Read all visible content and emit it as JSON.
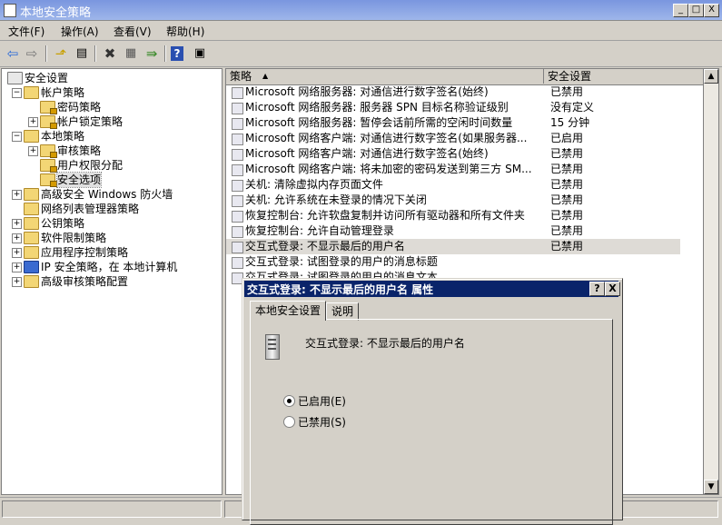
{
  "window": {
    "title": "本地安全策略",
    "min": "_",
    "max": "□",
    "close": "X"
  },
  "menu": [
    "文件(F)",
    "操作(A)",
    "查看(V)",
    "帮助(H)"
  ],
  "toolbar": [
    "back-icon",
    "forward-icon",
    "up-folder-icon",
    "show-hide-tree-icon",
    "delete-icon",
    "properties-icon",
    "export-icon",
    "help-icon",
    "console-icon"
  ],
  "tree": {
    "nodes": [
      {
        "label": "安全设置",
        "level": 0,
        "expander": "",
        "icon": "security-settings-icon"
      },
      {
        "label": "帐户策略",
        "level": 1,
        "expander": "-",
        "icon": "folder-icon"
      },
      {
        "label": "密码策略",
        "level": 2,
        "expander": "",
        "icon": "folder-icon"
      },
      {
        "label": "帐户锁定策略",
        "level": 2,
        "expander": "+",
        "icon": "folder-icon"
      },
      {
        "label": "本地策略",
        "level": 1,
        "expander": "-",
        "icon": "folder-icon"
      },
      {
        "label": "审核策略",
        "level": 2,
        "expander": "+",
        "icon": "folder-icon"
      },
      {
        "label": "用户权限分配",
        "level": 2,
        "expander": "",
        "icon": "folder-icon"
      },
      {
        "label": "安全选项",
        "level": 2,
        "expander": "",
        "icon": "folder-icon",
        "selected": true
      },
      {
        "label": "高级安全 Windows 防火墙",
        "level": 1,
        "expander": "+",
        "icon": "folder-icon"
      },
      {
        "label": "网络列表管理器策略",
        "level": 1,
        "expander": "",
        "icon": "folder-icon"
      },
      {
        "label": "公钥策略",
        "level": 1,
        "expander": "+",
        "icon": "folder-icon"
      },
      {
        "label": "软件限制策略",
        "level": 1,
        "expander": "+",
        "icon": "folder-icon"
      },
      {
        "label": "应用程序控制策略",
        "level": 1,
        "expander": "+",
        "icon": "folder-icon"
      },
      {
        "label": "IP 安全策略，在 本地计算机",
        "level": 1,
        "expander": "+",
        "icon": "ip-security-icon"
      },
      {
        "label": "高级审核策略配置",
        "level": 1,
        "expander": "+",
        "icon": "folder-icon"
      }
    ]
  },
  "list": {
    "columns": [
      "策略",
      "安全设置"
    ],
    "rows": [
      {
        "policy": "Microsoft 网络服务器: 对通信进行数字签名(始终)",
        "setting": "已禁用"
      },
      {
        "policy": "Microsoft 网络服务器: 服务器 SPN 目标名称验证级别",
        "setting": "没有定义"
      },
      {
        "policy": "Microsoft 网络服务器: 暂停会话前所需的空闲时间数量",
        "setting": "15 分钟"
      },
      {
        "policy": "Microsoft 网络客户端: 对通信进行数字签名(如果服务器...",
        "setting": "已启用"
      },
      {
        "policy": "Microsoft 网络客户端: 对通信进行数字签名(始终)",
        "setting": "已禁用"
      },
      {
        "policy": "Microsoft 网络客户端: 将未加密的密码发送到第三方 SM...",
        "setting": "已禁用"
      },
      {
        "policy": "关机: 清除虚拟内存页面文件",
        "setting": "已禁用"
      },
      {
        "policy": "关机: 允许系统在未登录的情况下关闭",
        "setting": "已禁用"
      },
      {
        "policy": "恢复控制台: 允许软盘复制并访问所有驱动器和所有文件夹",
        "setting": "已禁用"
      },
      {
        "policy": "恢复控制台: 允许自动管理登录",
        "setting": "已禁用"
      },
      {
        "policy": "交互式登录: 不显示最后的用户名",
        "setting": "已禁用",
        "selected": true
      },
      {
        "policy": "交互式登录: 试图登录的用户的消息标题",
        "setting": ""
      },
      {
        "policy": "交互式登录: 试图登录的用户的消息文本",
        "setting": ""
      }
    ]
  },
  "dialog": {
    "title": "交互式登录: 不显示最后的用户名 属性",
    "help_btn": "?",
    "close_btn": "X",
    "tabs": [
      "本地安全设置",
      "说明"
    ],
    "policy_name": "交互式登录: 不显示最后的用户名",
    "options": [
      {
        "label": "已启用(E)",
        "checked": true
      },
      {
        "label": "已禁用(S)",
        "checked": false
      }
    ]
  }
}
